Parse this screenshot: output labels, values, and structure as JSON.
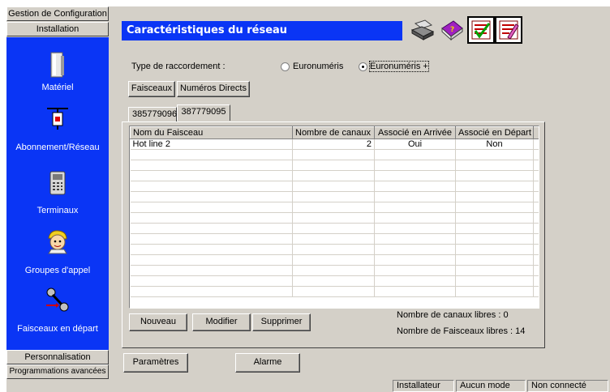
{
  "nav": {
    "top_buttons": [
      "Gestion de Configuration",
      "Installation"
    ],
    "items": [
      {
        "label": "Matériel",
        "icon": "hardware-icon"
      },
      {
        "label": "Abonnement/Réseau",
        "icon": "network-subscription-icon"
      },
      {
        "label": "Terminaux",
        "icon": "phone-terminal-icon"
      },
      {
        "label": "Groupes d'appel",
        "icon": "call-group-icon"
      },
      {
        "label": "Faisceaux en départ",
        "icon": "outgoing-trunk-icon"
      }
    ],
    "bottom_buttons": [
      "Personnalisation",
      "Programmations avancées"
    ]
  },
  "header": {
    "title": "Caractéristiques du réseau"
  },
  "toolbar": {
    "icons": [
      "printer-icon",
      "help-book-icon",
      "validate-icon",
      "edit-icon"
    ]
  },
  "connection": {
    "label": "Type de raccordement :",
    "options": [
      {
        "label": "Euronuméris",
        "selected": false
      },
      {
        "label": "Euronuméris +",
        "selected": true
      }
    ]
  },
  "tabs": {
    "main": [
      "Faisceaux",
      "Numéros Directs"
    ],
    "numbers": [
      "385779096",
      "387779095"
    ]
  },
  "table": {
    "columns": [
      "Nom du Faisceau",
      "Nombre de canaux",
      "Associé en Arrivée",
      "Associé en Départ"
    ],
    "rows": [
      [
        "Hot line 2",
        "2",
        "Oui",
        "Non"
      ]
    ]
  },
  "actions": {
    "new": "Nouveau",
    "modify": "Modifier",
    "delete": "Supprimer"
  },
  "info": {
    "free_channels": "Nombre de canaux libres : 0",
    "free_trunks": "Nombre de Faisceaux libres : 14"
  },
  "bottom": {
    "params": "Paramètres",
    "alarm": "Alarme"
  },
  "status": [
    "Installateur",
    "Aucun mode",
    "Non connecté"
  ],
  "colors": {
    "accent_blue": "#0a35f5",
    "panel_gray": "#d4d0c8"
  }
}
